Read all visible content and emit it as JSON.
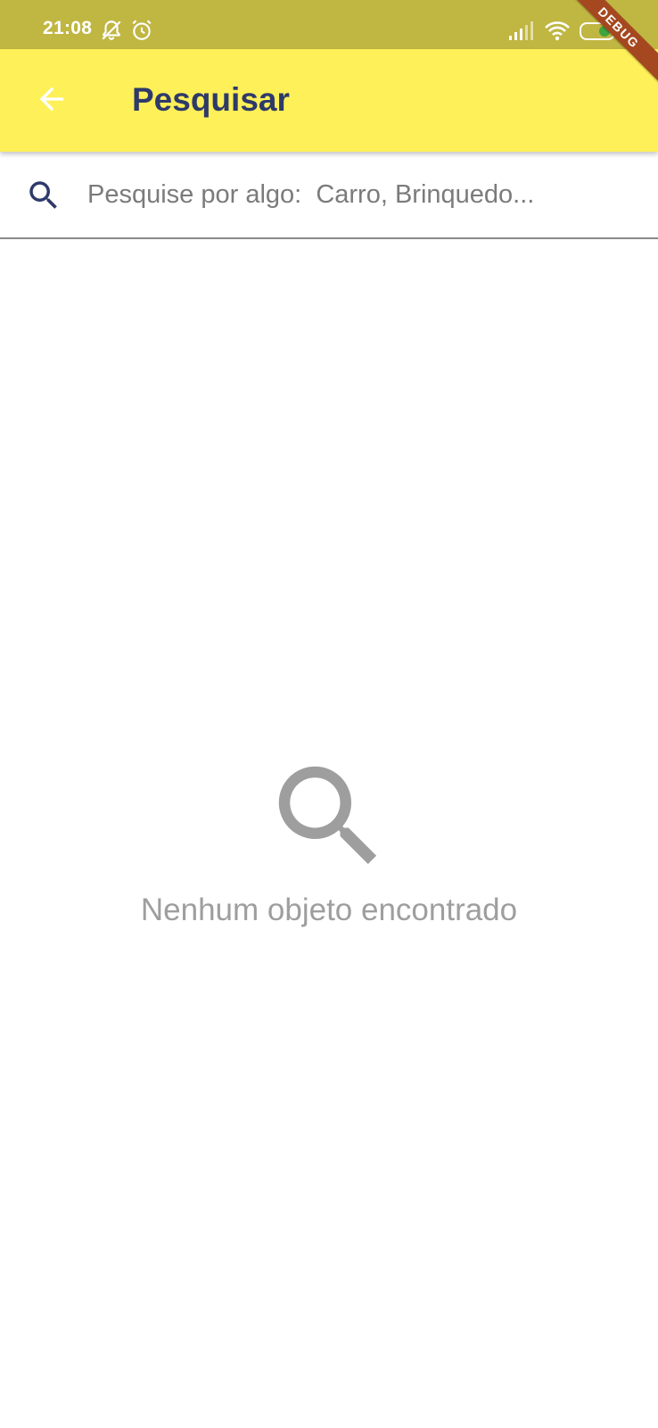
{
  "status_bar": {
    "time": "21:08",
    "icons": [
      "notifications-off-icon",
      "alarm-icon",
      "signal-icon",
      "wifi-icon",
      "battery-icon"
    ]
  },
  "debug_banner": "DEBUG",
  "app_bar": {
    "back_icon": "arrow-back-icon",
    "title": "Pesquisar"
  },
  "search": {
    "icon": "search-icon",
    "placeholder": "Pesquise por algo:  Carro, Brinquedo...",
    "value": ""
  },
  "empty_state": {
    "icon": "search-icon",
    "message": "Nenhum objeto encontrado"
  },
  "colors": {
    "status_bar": "#c0b642",
    "app_bar": "#fef058",
    "title": "#2e3a6a",
    "search_icon": "#2e3a6a",
    "empty_grey": "#9e9e9e",
    "debug_ribbon": "#a5481f"
  }
}
